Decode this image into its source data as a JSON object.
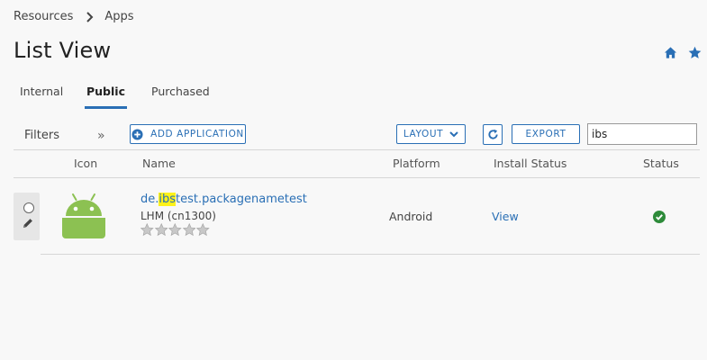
{
  "breadcrumb": {
    "root": "Resources",
    "current": "Apps"
  },
  "page": {
    "title": "List View"
  },
  "header_icons": [
    "home-icon",
    "star-icon"
  ],
  "tabs": [
    {
      "label": "Internal",
      "active": false
    },
    {
      "label": "Public",
      "active": true
    },
    {
      "label": "Purchased",
      "active": false
    }
  ],
  "toolbar": {
    "filters_label": "Filters",
    "collapse_glyph": "»",
    "add_application": "ADD APPLICATION",
    "layout": "LAYOUT",
    "export": "EXPORT",
    "search_value": "ibs"
  },
  "table": {
    "columns": [
      "Icon",
      "Name",
      "Platform",
      "Install Status",
      "Status"
    ],
    "rows": [
      {
        "name_prefix": "de.",
        "name_highlight": "ibs",
        "name_suffix": "test.packagenametest",
        "subtitle": "LHM (cn1300)",
        "rating": 0,
        "rating_max": 5,
        "platform": "Android",
        "install_status": "View",
        "status": "check-circle-icon"
      }
    ]
  },
  "colors": {
    "accent": "#2a6fb5",
    "android_green": "#8cc152",
    "status_ok": "#2e8b3a",
    "highlight": "#fdf21a"
  }
}
